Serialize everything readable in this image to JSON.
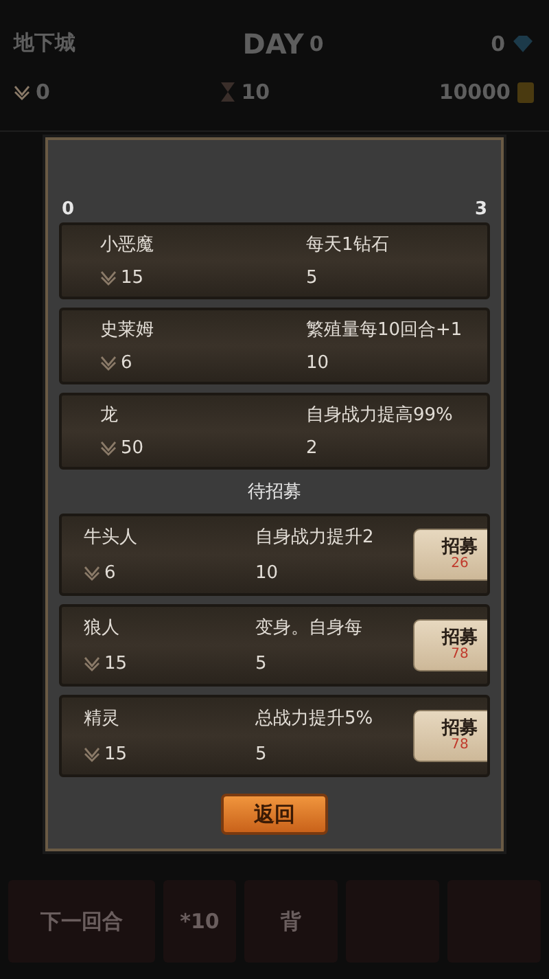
{
  "header": {
    "title": "地下城",
    "day_label": "DAY",
    "day": "0",
    "gems": "0",
    "power": "0",
    "hourglass": "10",
    "gold": "10000"
  },
  "dialog": {
    "left_count": "0",
    "right_count": "3",
    "owned": [
      {
        "name": "小恶魔",
        "power": "15",
        "effect": "每天1钻石",
        "count": "5"
      },
      {
        "name": "史莱姆",
        "power": "6",
        "effect": "繁殖量每10回合+1",
        "count": "10"
      },
      {
        "name": "龙",
        "power": "50",
        "effect": "自身战力提高99%",
        "count": "2"
      }
    ],
    "recruit_title": "待招募",
    "recruits": [
      {
        "name": "牛头人",
        "power": "6",
        "effect": "自身战力提升2",
        "count": "10",
        "button": "招募",
        "cost": "26"
      },
      {
        "name": "狼人",
        "power": "15",
        "effect": "变身。自身每",
        "count": "5",
        "button": "招募",
        "cost": "78"
      },
      {
        "name": "精灵",
        "power": "15",
        "effect": "总战力提升5%",
        "count": "5",
        "button": "招募",
        "cost": "78"
      }
    ],
    "back": "返回"
  },
  "bottom_bar": [
    {
      "label": "下一回合"
    },
    {
      "label": "*10"
    },
    {
      "label": "背"
    }
  ]
}
